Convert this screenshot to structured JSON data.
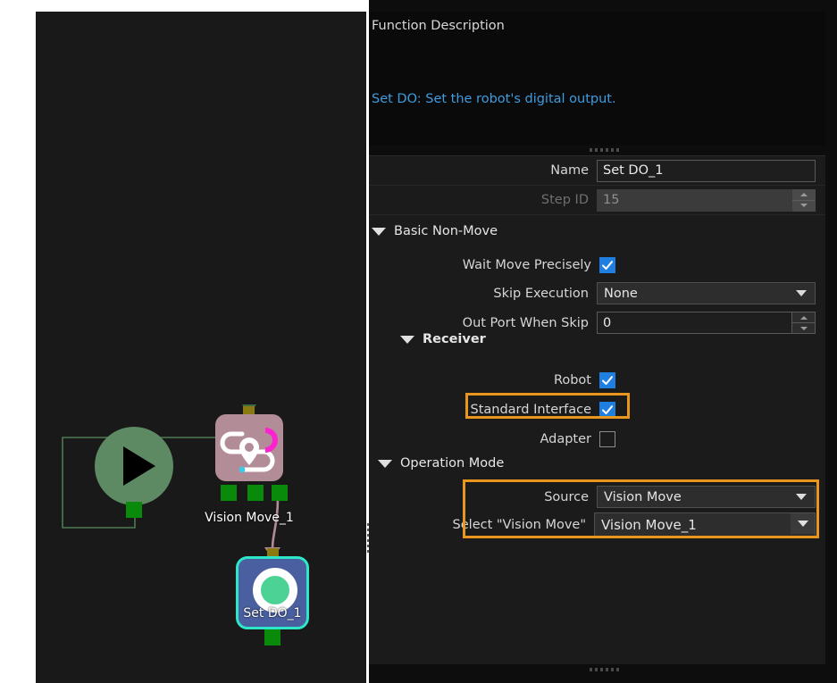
{
  "description_panel": {
    "title": "Function Description",
    "text": "Set DO: Set the robot's digital output."
  },
  "properties": {
    "name_row": {
      "label": "Name",
      "value": "Set DO_1"
    },
    "step_id_row": {
      "label": "Step ID",
      "value": "15",
      "disabled": true
    },
    "groups": {
      "basic_non_move": {
        "label": "Basic Non-Move",
        "expanded": true,
        "fields": {
          "wait_move_precisely": {
            "label": "Wait Move Precisely",
            "checked": true
          },
          "skip_execution": {
            "label": "Skip Execution",
            "value": "None"
          },
          "out_port_when_skip": {
            "label": "Out Port When Skip",
            "value": "0"
          }
        }
      },
      "receiver": {
        "label": "Receiver",
        "expanded": true,
        "fields": {
          "robot": {
            "label": "Robot",
            "checked": true
          },
          "standard_interface": {
            "label": "Standard Interface",
            "checked": true,
            "highlighted": true
          },
          "adapter": {
            "label": "Adapter",
            "checked": false
          }
        }
      },
      "operation_mode": {
        "label": "Operation Mode",
        "expanded": true,
        "highlighted": true,
        "fields": {
          "source": {
            "label": "Source",
            "value": "Vision Move"
          },
          "select_vision_move": {
            "label": "Select \"Vision Move\"",
            "value": "Vision Move_1"
          }
        }
      }
    }
  },
  "canvas": {
    "nodes": {
      "start": {
        "label": "",
        "icon": "play-icon"
      },
      "vision_move": {
        "label": "Vision Move_1",
        "icon": "vision-move-icon"
      },
      "set_do": {
        "label": "Set DO_1",
        "icon": "set-do-icon",
        "selected": true
      }
    }
  },
  "colors": {
    "highlight": "#e8961e",
    "accent_blue": "#1f7fe0",
    "link_text": "#3e9ce0",
    "selection_cyan": "#2ee6c8",
    "panel_bg": "#1b1b1b",
    "canvas_bg": "#191919",
    "start_node": "#5e8a63",
    "vision_node": "#b28d98",
    "set_do_node": "#4a5fa0",
    "port_green": "#0a8a0a"
  }
}
